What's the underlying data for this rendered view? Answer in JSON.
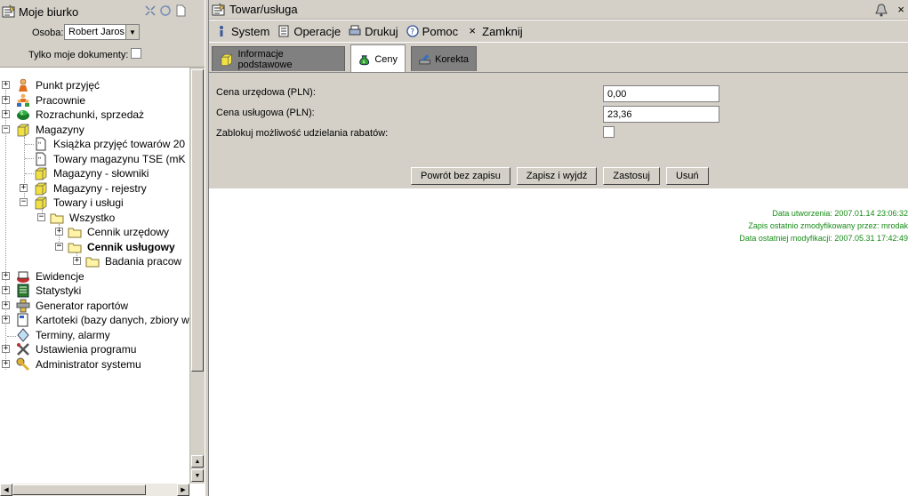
{
  "left_panel": {
    "title": "Moje biurko",
    "osoba_label": "Osoba:",
    "osoba_value": "Robert Jaros",
    "tylko_label": "Tylko moje dokumenty:",
    "tree": {
      "punkt": "Punkt przyjęć",
      "pracownie": "Pracownie",
      "rozrachunki": "Rozrachunki, sprzedaż",
      "magazyny": "Magazyny",
      "ksiazka": "Książka przyjęć towarów 20",
      "towary_tse": "Towary magazynu TSE (mK",
      "mag_slowniki": "Magazyny - słowniki",
      "mag_rejestry": "Magazyny - rejestry",
      "towary_uslugi": "Towary i usługi",
      "wszystko": "Wszystko",
      "cennik_urzedowy": "Cennik urzędowy",
      "cennik_uslugowy": "Cennik usługowy",
      "badania": "Badania pracow",
      "ewidencje": "Ewidencje",
      "statystyki": "Statystyki",
      "generator": "Generator raportów",
      "kartoteki": "Kartoteki (bazy danych, zbiory w",
      "terminy": "Terminy, alarmy",
      "ustawienia": "Ustawienia programu",
      "administrator": "Administrator systemu"
    }
  },
  "right_panel": {
    "title": "Towar/usługa",
    "menu": {
      "system": "System",
      "operacje": "Operacje",
      "drukuj": "Drukuj",
      "pomoc": "Pomoc",
      "zamknij": "Zamknij"
    },
    "tabs": {
      "info": "Informacje podstawowe",
      "ceny": "Ceny",
      "korekta": "Korekta"
    },
    "form": {
      "cena_urzedowa_label": "Cena urzędowa (PLN):",
      "cena_urzedowa_value": "0,00",
      "cena_uslugowa_label": "Cena usługowa (PLN):",
      "cena_uslugowa_value": "23,36",
      "zablokuj_label": "Zablokuj możliwość udzielania rabatów:"
    },
    "buttons": {
      "powrot": "Powrót bez zapisu",
      "zapisz": "Zapisz i wyjdź",
      "zastosuj": "Zastosuj",
      "usun": "Usuń"
    },
    "meta": {
      "utworzenia": "Data utworzenia: 2007.01.14 23:06:32",
      "zapis": "Zapis ostatnio zmodyfikowany przez: mrodak",
      "modyfikacji": "Data ostatniej modyfikacji: 2007.05.31 17:42:49"
    }
  },
  "colors": {
    "panel_bg": "#d4d0c8",
    "meta_text": "#168c16",
    "inactive_tab": "#808080"
  }
}
